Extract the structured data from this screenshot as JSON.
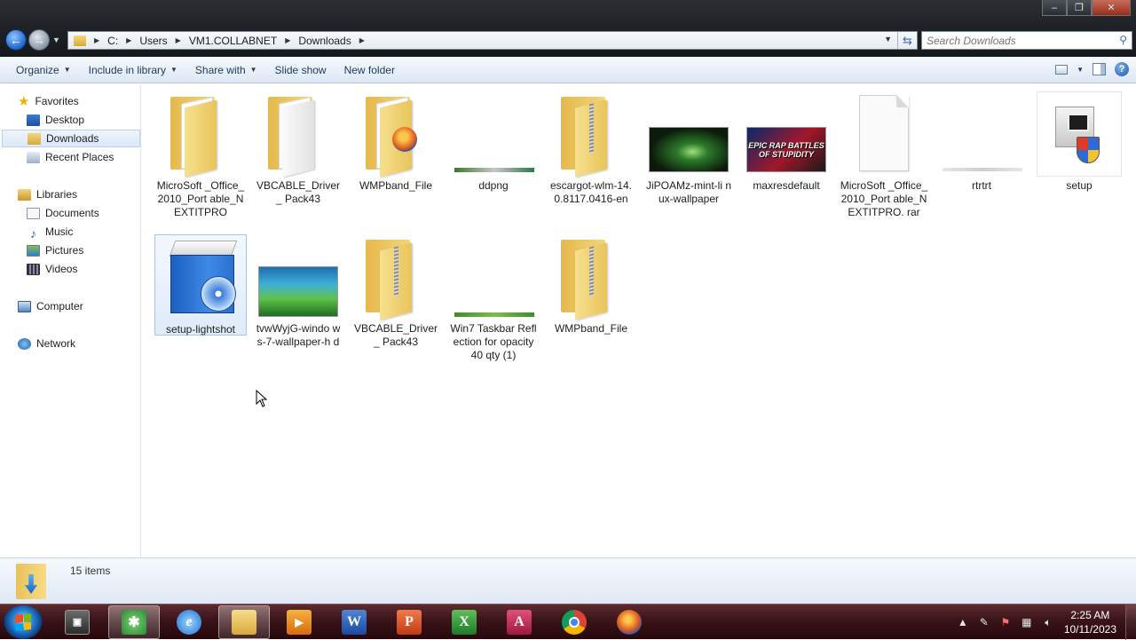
{
  "window": {
    "controls": {
      "minimize": "–",
      "maximize": "❐",
      "close": "✕"
    }
  },
  "address": {
    "crumbs": [
      "C:",
      "Users",
      "VM1.COLLABNET",
      "Downloads"
    ]
  },
  "search": {
    "placeholder": "Search Downloads"
  },
  "toolbar": {
    "organize": "Organize",
    "include_in_library": "Include in library",
    "share_with": "Share with",
    "slide_show": "Slide show",
    "new_folder": "New folder",
    "help": "?"
  },
  "nav": {
    "favorites": "Favorites",
    "desktop": "Desktop",
    "downloads": "Downloads",
    "recent_places": "Recent Places",
    "libraries": "Libraries",
    "documents": "Documents",
    "music": "Music",
    "pictures": "Pictures",
    "videos": "Videos",
    "computer": "Computer",
    "network": "Network"
  },
  "files": [
    {
      "name": "MicroSoft _Office_2010_Port able_NEXTITPRO",
      "type": "folder"
    },
    {
      "name": "VBCABLE_Driver_ Pack43",
      "type": "folder"
    },
    {
      "name": "WMPband_File",
      "type": "folder-firefox"
    },
    {
      "name": "ddpng",
      "type": "image-strip"
    },
    {
      "name": "escargot-wlm-14. 0.8117.0416-en",
      "type": "zip"
    },
    {
      "name": "JiPOAMz-mint-li nux-wallpaper",
      "type": "image"
    },
    {
      "name": "maxresdefault",
      "type": "image"
    },
    {
      "name": "MicroSoft _Office_2010_Port able_NEXTITPRO. rar",
      "type": "blank"
    },
    {
      "name": "rtrtrt",
      "type": "image-strip"
    },
    {
      "name": "setup",
      "type": "setup"
    },
    {
      "name": "setup-lightshot",
      "type": "installer"
    },
    {
      "name": "tvwWyjG-windo ws-7-wallpaper-h d",
      "type": "image"
    },
    {
      "name": "VBCABLE_Driver_ Pack43",
      "type": "zip"
    },
    {
      "name": "Win7 Taskbar Reflection for opacity 40 qty (1)",
      "type": "image-strip"
    },
    {
      "name": "WMPband_File",
      "type": "zip"
    }
  ],
  "thumb_text": {
    "maxres": "EPIC RAP BATTLES OF STUPIDITY"
  },
  "status": {
    "item_count": "15 items"
  },
  "taskbar": {
    "word_letter": "W",
    "ppt_letter": "P",
    "excel_letter": "X",
    "access_letter": "A"
  },
  "clock": {
    "time": "2:25 AM",
    "date": "10/11/2023"
  },
  "colors": {
    "taskbar": "#3a1418",
    "accent": "#1e395b",
    "selection": "#dbe8f7"
  }
}
